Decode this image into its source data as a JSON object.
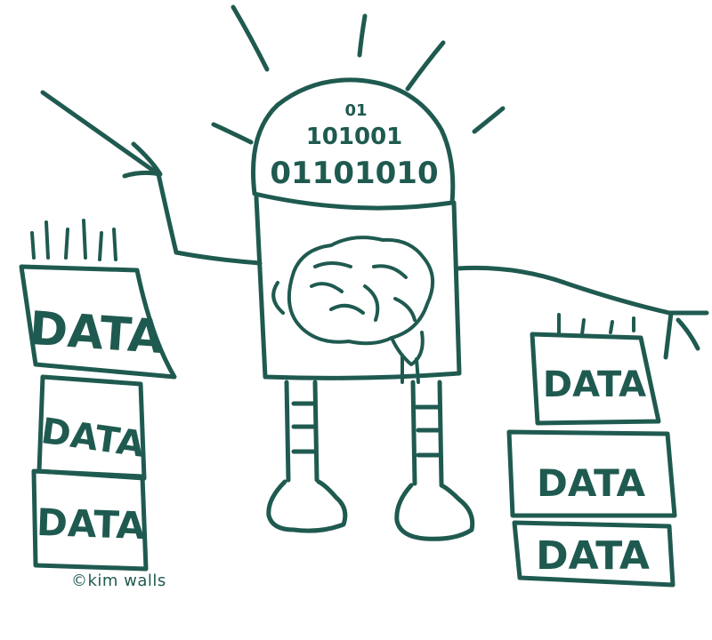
{
  "stacks": {
    "left": [
      "DATA",
      "DATA",
      "DATA"
    ],
    "right": [
      "DATA",
      "DATA",
      "DATA"
    ]
  },
  "robot": {
    "binary_line1": "01",
    "binary_line2": "101001",
    "binary_line3": "01101010"
  },
  "credit": "©kim walls"
}
